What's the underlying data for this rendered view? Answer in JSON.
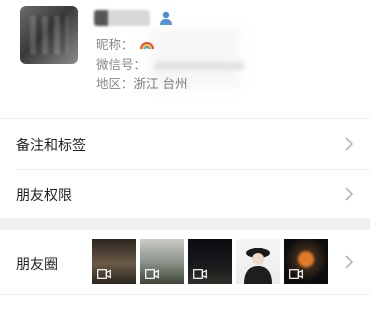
{
  "profile": {
    "name_obscured": "",
    "nickname_label": "昵称：",
    "wechat_id_label": "微信号：",
    "region_label": "地区：",
    "region_value": "浙江 台州",
    "contact_icon": "contact-person-icon",
    "nickname_emoji": "rainbow-icon"
  },
  "rows": {
    "remarks_label": "备注和标签",
    "permissions_label": "朋友权限",
    "moments_label": "朋友圈"
  },
  "moments": {
    "thumbnails": [
      {
        "name": "moment-thumb-1",
        "video": true
      },
      {
        "name": "moment-thumb-2",
        "video": true
      },
      {
        "name": "moment-thumb-3",
        "video": true
      },
      {
        "name": "moment-thumb-4",
        "video": false
      },
      {
        "name": "moment-thumb-5",
        "video": true
      }
    ]
  },
  "colors": {
    "background": "#ffffff",
    "section_gap": "#f1f1f1",
    "divider": "#ececec",
    "secondary_text": "#888888",
    "contact_icon_blue": "#4a8fd6"
  }
}
